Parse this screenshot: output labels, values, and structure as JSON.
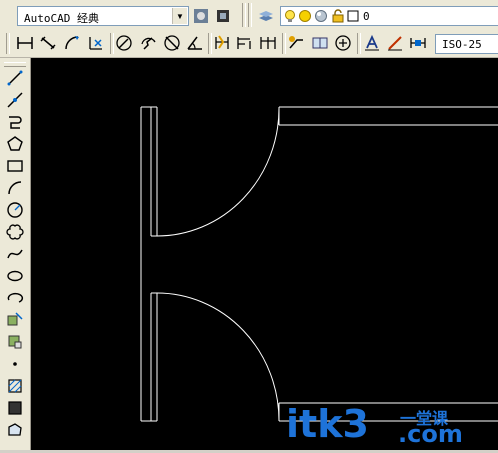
{
  "toolbar_top": {
    "workspace_value": "AutoCAD 经典",
    "layer_value": "0"
  },
  "toolbar_dim": {
    "dimstyle_value": "ISO-25"
  },
  "watermark": {
    "brand": "itk3",
    "chinese": "一堂课",
    "domain": ".com"
  },
  "colors": {
    "canvas_bg": "#000000",
    "drawing_line": "#ffffff",
    "watermark": "#1e73d9"
  }
}
